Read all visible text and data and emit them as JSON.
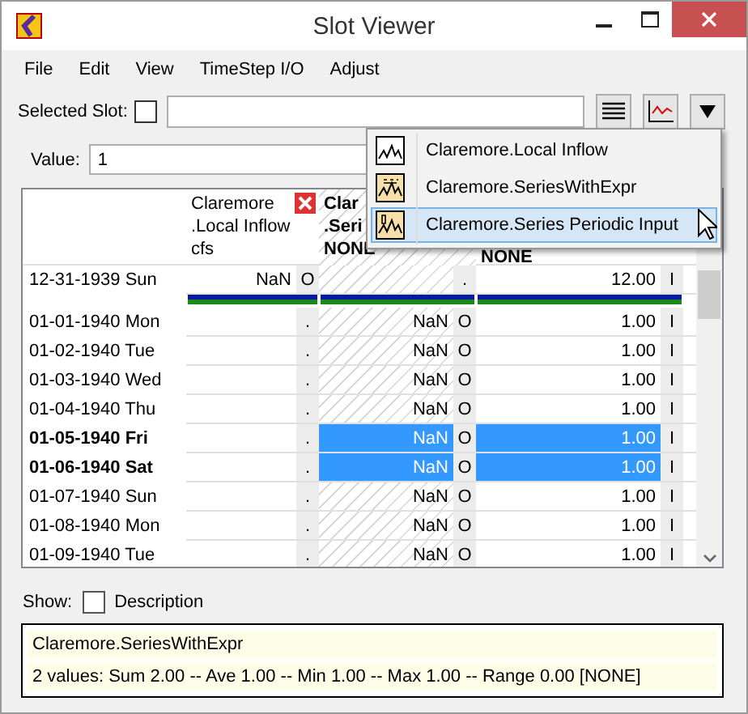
{
  "window": {
    "title": "Slot Viewer"
  },
  "menu": [
    "File",
    "Edit",
    "View",
    "TimeStep I/O",
    "Adjust"
  ],
  "selected_slot": {
    "label": "Selected Slot:",
    "checked": false
  },
  "value_field": {
    "label": "Value:",
    "value": "1"
  },
  "columns": [
    {
      "lines": [
        "Claremore",
        ".Local Inflow",
        "cfs"
      ],
      "bold": false,
      "removable": true,
      "hatched": false
    },
    {
      "lines": [
        "Clar",
        ".Seri",
        "NONE"
      ],
      "bold": true,
      "removable": false,
      "hatched": true
    },
    {
      "lines": [
        "NONE"
      ],
      "bold": true,
      "removable": false,
      "hatched": false
    }
  ],
  "rows": [
    {
      "date": "12-31-1939 Sun",
      "selected": false,
      "separator_after": true,
      "cells": [
        {
          "value": "NaN",
          "flag": "O"
        },
        {
          "flag": "."
        },
        {
          "value": "12.00",
          "flag": "I"
        }
      ]
    },
    {
      "date": "01-01-1940 Mon",
      "selected": false,
      "separator_after": false,
      "cells": [
        {
          "flag": "."
        },
        {
          "value": "NaN",
          "flag": "O"
        },
        {
          "value": "1.00",
          "flag": "I"
        }
      ]
    },
    {
      "date": "01-02-1940 Tue",
      "selected": false,
      "separator_after": false,
      "cells": [
        {
          "flag": "."
        },
        {
          "value": "NaN",
          "flag": "O"
        },
        {
          "value": "1.00",
          "flag": "I"
        }
      ]
    },
    {
      "date": "01-03-1940 Wed",
      "selected": false,
      "separator_after": false,
      "cells": [
        {
          "flag": "."
        },
        {
          "value": "NaN",
          "flag": "O"
        },
        {
          "value": "1.00",
          "flag": "I"
        }
      ]
    },
    {
      "date": "01-04-1940 Thu",
      "selected": false,
      "separator_after": false,
      "cells": [
        {
          "flag": "."
        },
        {
          "value": "NaN",
          "flag": "O"
        },
        {
          "value": "1.00",
          "flag": "I"
        }
      ]
    },
    {
      "date": "01-05-1940 Fri",
      "selected": true,
      "separator_after": false,
      "cells": [
        {
          "flag": "."
        },
        {
          "value": "NaN",
          "flag": "O"
        },
        {
          "value": "1.00",
          "flag": "I"
        }
      ]
    },
    {
      "date": "01-06-1940 Sat",
      "selected": true,
      "separator_after": false,
      "cells": [
        {
          "flag": "."
        },
        {
          "value": "NaN",
          "flag": "O"
        },
        {
          "value": "1.00",
          "flag": "I"
        }
      ]
    },
    {
      "date": "01-07-1940 Sun",
      "selected": false,
      "separator_after": false,
      "cells": [
        {
          "flag": "."
        },
        {
          "value": "NaN",
          "flag": "O"
        },
        {
          "value": "1.00",
          "flag": "I"
        }
      ]
    },
    {
      "date": "01-08-1940 Mon",
      "selected": false,
      "separator_after": false,
      "cells": [
        {
          "flag": "."
        },
        {
          "value": "NaN",
          "flag": "O"
        },
        {
          "value": "1.00",
          "flag": "I"
        }
      ]
    },
    {
      "date": "01-09-1940 Tue",
      "selected": false,
      "separator_after": false,
      "cells": [
        {
          "flag": "."
        },
        {
          "value": "NaN",
          "flag": "O"
        },
        {
          "value": "1.00",
          "flag": "I"
        }
      ]
    }
  ],
  "slot_menu": [
    {
      "label": "Claremore.Local Inflow",
      "kind": "plain",
      "selected": false
    },
    {
      "label": "Claremore.SeriesWithExpr",
      "kind": "expr",
      "selected": false
    },
    {
      "label": "Claremore.Series Periodic Input",
      "kind": "periodic",
      "selected": true
    }
  ],
  "show": {
    "label": "Show:",
    "option": "Description",
    "checked": false
  },
  "info": [
    "Claremore.SeriesWithExpr",
    "2 values:  Sum 2.00 -- Ave 1.00 -- Min 1.00 -- Max 1.00 -- Range 0.00 [NONE]"
  ]
}
